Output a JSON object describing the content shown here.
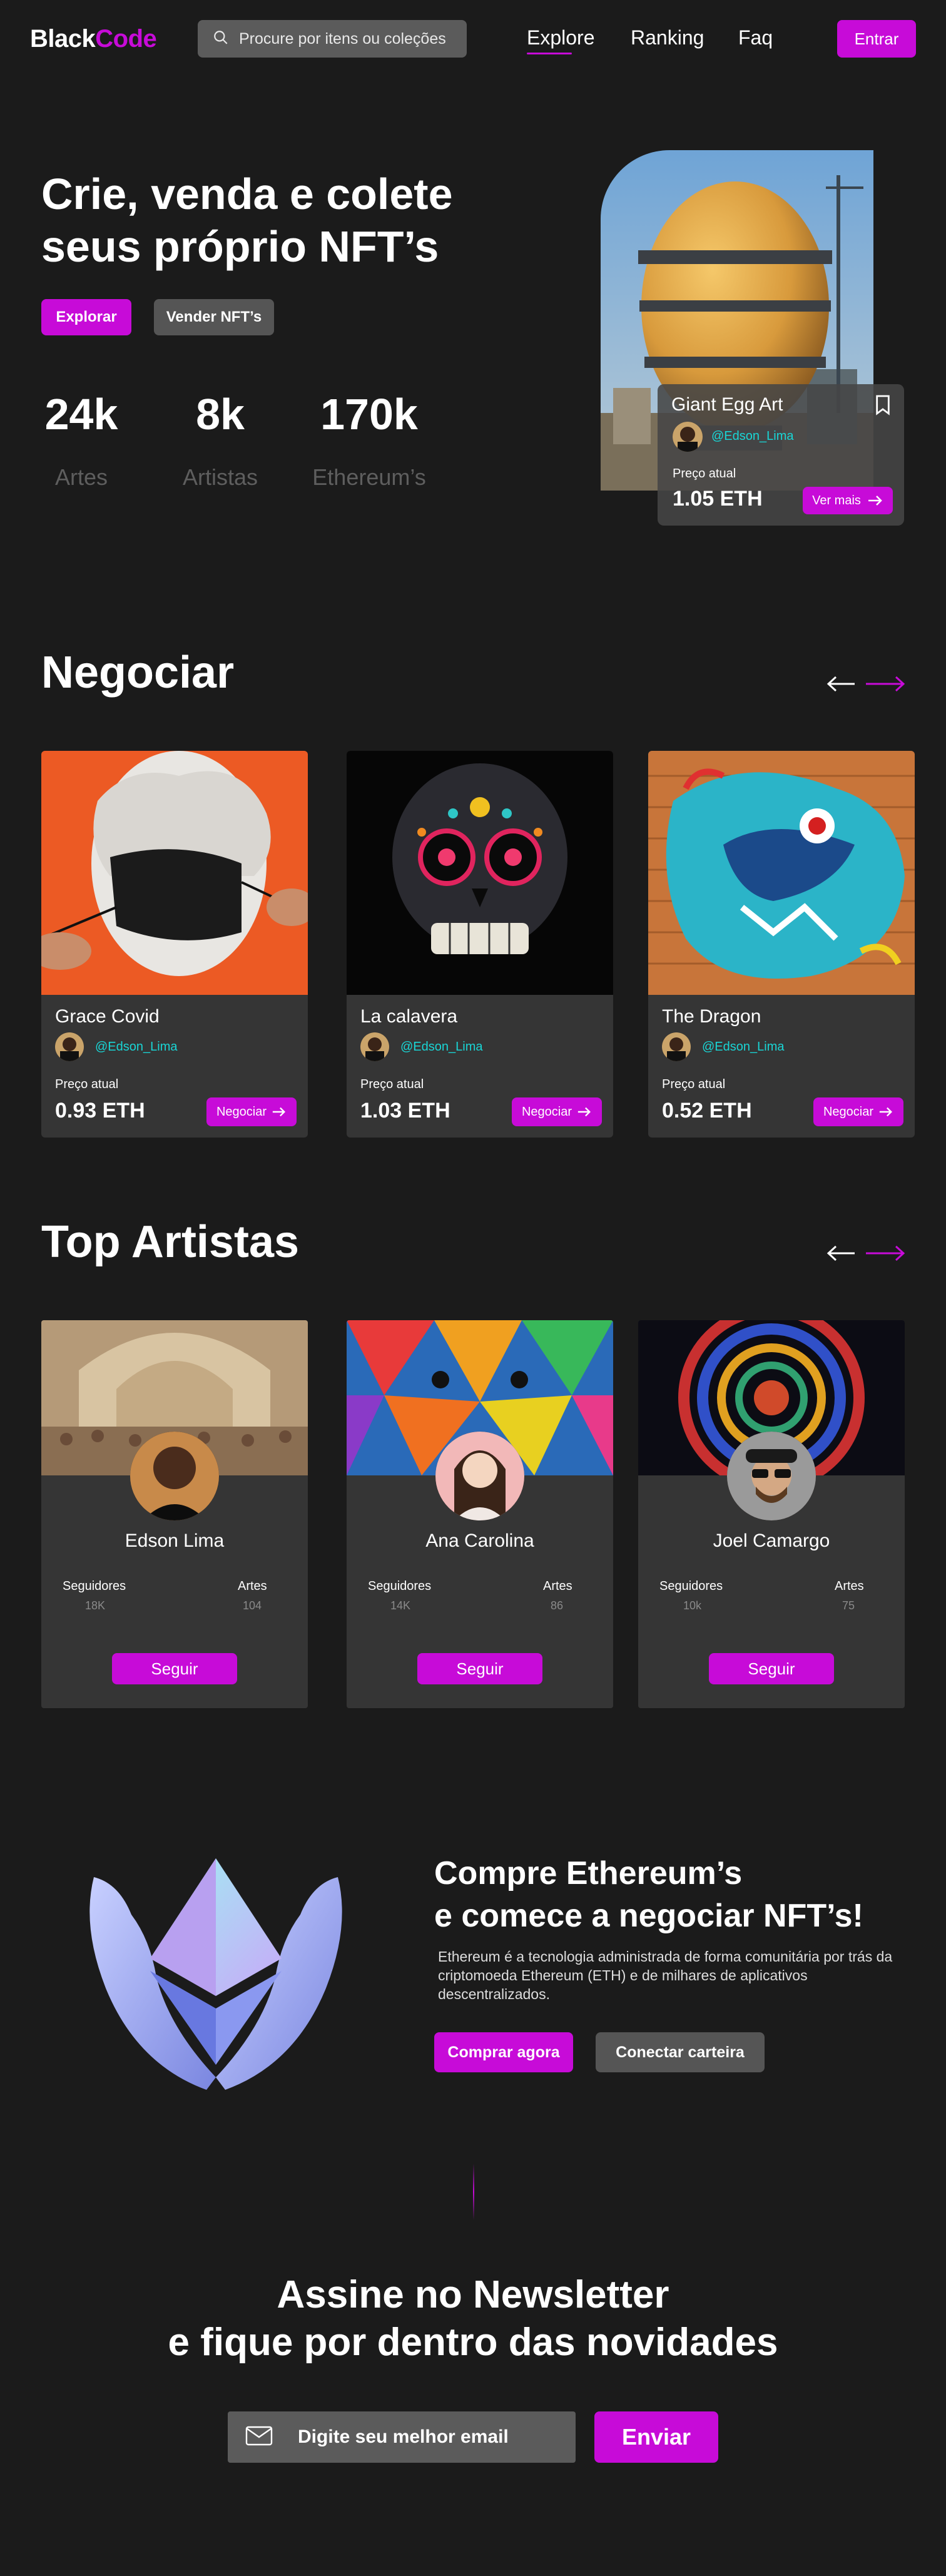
{
  "nav": {
    "logo_black": "Black",
    "logo_code": "Code",
    "search_placeholder": "Procure por itens ou coleções",
    "links": [
      "Explore",
      "Ranking",
      "Faq"
    ],
    "login": "Entrar"
  },
  "hero": {
    "title_line1": "Crie, venda e colete",
    "title_line2": "seus próprio NFT’s",
    "btn_explore": "Explorar",
    "btn_sell": "Vender NFT’s",
    "stats": [
      {
        "value": "24k",
        "label": "Artes"
      },
      {
        "value": "8k",
        "label": "Artistas"
      },
      {
        "value": "170k",
        "label": "Ethereum’s"
      }
    ],
    "featured": {
      "name": "Giant Egg Art",
      "user": "@Edson_Lima",
      "price_label": "Preço atual",
      "price": "1.05 ETH",
      "button": "Ver mais"
    }
  },
  "trade": {
    "title": "Negociar",
    "items": [
      {
        "name": "Grace Covid",
        "user": "@Edson_Lima",
        "price_label": "Preço atual",
        "price": "0.93 ETH",
        "button": "Negociar"
      },
      {
        "name": "La calavera",
        "user": "@Edson_Lima",
        "price_label": "Preço atual",
        "price": "1.03 ETH",
        "button": "Negociar"
      },
      {
        "name": "The Dragon",
        "user": "@Edson_Lima",
        "price_label": "Preço atual",
        "price": "0.52 ETH",
        "button": "Negociar"
      }
    ]
  },
  "artists": {
    "title": "Top Artistas",
    "followers_label": "Seguidores",
    "arts_label": "Artes",
    "follow": "Seguir",
    "items": [
      {
        "name": "Edson Lima",
        "followers": "18K",
        "arts": "104"
      },
      {
        "name": "Ana Carolina",
        "followers": "14K",
        "arts": "86"
      },
      {
        "name": "Joel Camargo",
        "followers": "10k",
        "arts": "75"
      }
    ]
  },
  "eth": {
    "title_line1": "Compre Ethereum’s",
    "title_line2": "e comece a negociar NFT’s!",
    "description": "Ethereum é a tecnologia administrada de forma comunitária por trás da criptomoeda Ethereum (ETH) e de milhares de aplicativos descentralizados.",
    "buy": "Comprar agora",
    "wallet": "Conectar carteira"
  },
  "newsletter": {
    "title_line1": "Assine no Newsletter",
    "title_line2": "e fique por dentro das novidades",
    "placeholder": "Digite seu melhor email",
    "send": "Enviar"
  },
  "colors": {
    "accent": "#c70bd8",
    "background": "#1b1b1b",
    "card": "#353535",
    "username": "#19d6d6"
  }
}
